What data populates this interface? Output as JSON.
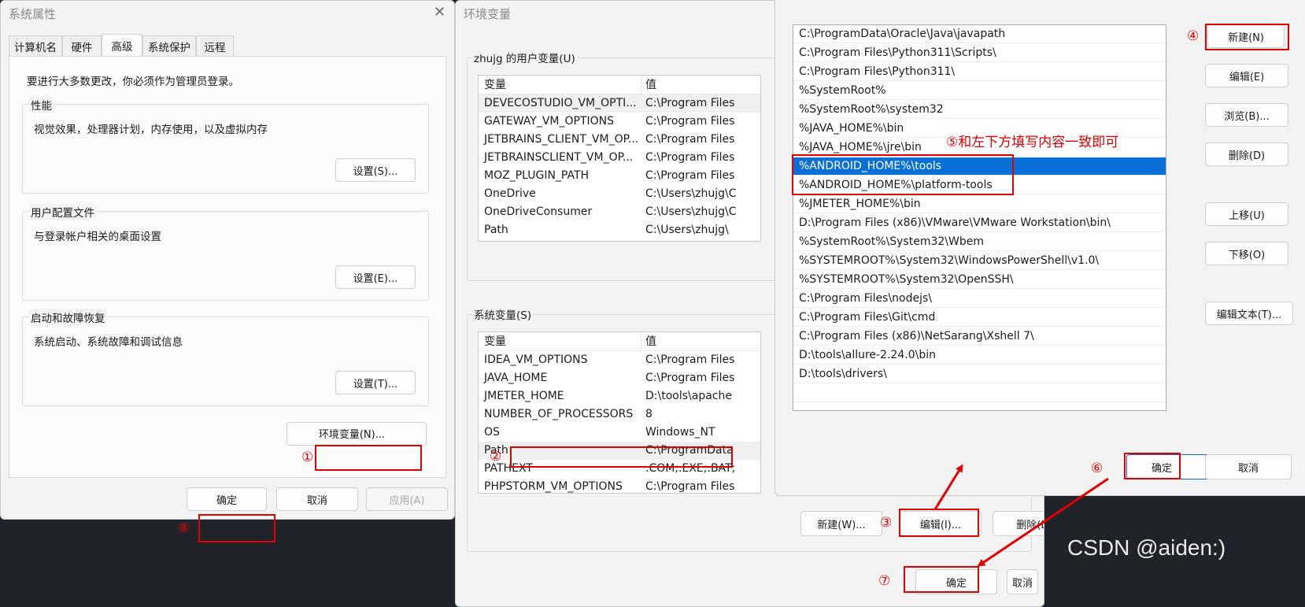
{
  "sys_props": {
    "title": "系统属性",
    "tabs": [
      "计算机名",
      "硬件",
      "高级",
      "系统保护",
      "远程"
    ],
    "admin_note": "要进行大多数更改，你必须作为管理员登录。",
    "performance": {
      "title": "性能",
      "desc": "视觉效果，处理器计划，内存使用，以及虚拟内存",
      "button": "设置(S)..."
    },
    "profiles": {
      "title": "用户配置文件",
      "desc": "与登录帐户相关的桌面设置",
      "button": "设置(E)..."
    },
    "startup": {
      "title": "启动和故障恢复",
      "desc": "系统启动、系统故障和调试信息",
      "button": "设置(T)..."
    },
    "env_button": "环境变量(N)...",
    "ok": "确定",
    "cancel": "取消",
    "apply": "应用(A)"
  },
  "env_vars": {
    "title": "环境变量",
    "user_section": "zhujg 的用户变量(U)",
    "system_section": "系统变量(S)",
    "col_var": "变量",
    "col_val": "值",
    "user_rows": [
      {
        "name": "DEVECOSTUDIO_VM_OPTI...",
        "value": "C:\\Program Files"
      },
      {
        "name": "GATEWAY_VM_OPTIONS",
        "value": "C:\\Program Files"
      },
      {
        "name": "JETBRAINS_CLIENT_VM_OP...",
        "value": "C:\\Program Files"
      },
      {
        "name": "JETBRAINSCLIENT_VM_OP...",
        "value": "C:\\Program Files"
      },
      {
        "name": "MOZ_PLUGIN_PATH",
        "value": "C:\\Program Files"
      },
      {
        "name": "OneDrive",
        "value": "C:\\Users\\zhujg\\C"
      },
      {
        "name": "OneDriveConsumer",
        "value": "C:\\Users\\zhujg\\C"
      },
      {
        "name": "Path",
        "value": "C:\\Users\\zhujg\\"
      }
    ],
    "sys_rows": [
      {
        "name": "IDEA_VM_OPTIONS",
        "value": "C:\\Program Files"
      },
      {
        "name": "JAVA_HOME",
        "value": "C:\\Program Files"
      },
      {
        "name": "JMETER_HOME",
        "value": "D:\\tools\\apache"
      },
      {
        "name": "NUMBER_OF_PROCESSORS",
        "value": "8"
      },
      {
        "name": "OS",
        "value": "Windows_NT"
      },
      {
        "name": "Path",
        "value": "C:\\ProgramData"
      },
      {
        "name": "PATHEXT",
        "value": ".COM;.EXE;.BAT;"
      },
      {
        "name": "PHPSTORM_VM_OPTIONS",
        "value": "C:\\Program Files"
      }
    ],
    "new_button": "新建(W)...",
    "edit_button": "编辑(I)...",
    "delete_button": "删除(L)",
    "ok": "确定",
    "cancel": "取消"
  },
  "edit_path": {
    "entries": [
      "C:\\ProgramData\\Oracle\\Java\\javapath",
      "C:\\Program Files\\Python311\\Scripts\\",
      "C:\\Program Files\\Python311\\",
      "%SystemRoot%",
      "%SystemRoot%\\system32",
      "%JAVA_HOME%\\bin",
      "%JAVA_HOME%\\jre\\bin",
      "%ANDROID_HOME%\\tools",
      "%ANDROID_HOME%\\platform-tools",
      "%JMETER_HOME%\\bin",
      "D:\\Program Files (x86)\\VMware\\VMware Workstation\\bin\\",
      "%SystemRoot%\\System32\\Wbem",
      "%SYSTEMROOT%\\System32\\WindowsPowerShell\\v1.0\\",
      "%SYSTEMROOT%\\System32\\OpenSSH\\",
      "C:\\Program Files\\nodejs\\",
      "C:\\Program Files\\Git\\cmd",
      "C:\\Program Files (x86)\\NetSarang\\Xshell 7\\",
      "D:\\tools\\allure-2.24.0\\bin",
      "D:\\tools\\drivers\\"
    ],
    "selected_index": 7,
    "new_button": "新建(N)",
    "edit_button": "编辑(E)",
    "browse_button": "浏览(B)...",
    "delete_button": "删除(D)",
    "move_up_button": "上移(U)",
    "move_down_button": "下移(O)",
    "edit_text_button": "编辑文本(T)...",
    "ok": "确定",
    "cancel": "取消"
  },
  "annotations": {
    "n1": "①",
    "n2": "②",
    "n3": "③",
    "n4": "④",
    "n5_text": "⑤和左下方填写内容一致即可",
    "n6": "⑥",
    "n7": "⑦",
    "n8": "⑧"
  },
  "watermark": "CSDN @aiden:)",
  "colors": {
    "selection": "#0a6fd6",
    "annotation": "#e00000",
    "background": "#20242a"
  }
}
